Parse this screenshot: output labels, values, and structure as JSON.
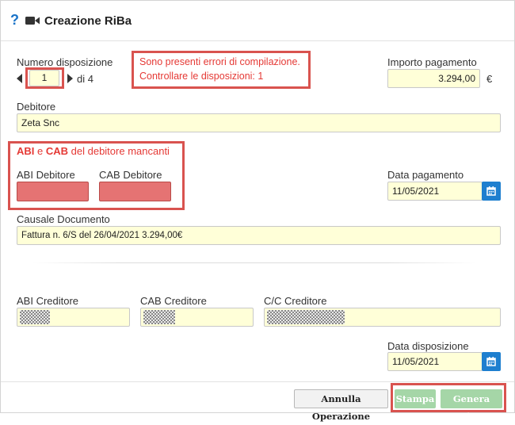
{
  "header": {
    "title": "Creazione RiBa",
    "help_icon": "?",
    "video_icon": "video-camera-icon"
  },
  "numero_disposizione": {
    "label": "Numero disposizione",
    "value": "1",
    "of_label": "di 4"
  },
  "errors": {
    "line1": "Sono presenti errori di compilazione.",
    "line2": "Controllare le disposizioni: 1"
  },
  "importo": {
    "label": "Importo pagamento",
    "value": "3.294,00",
    "currency": "€"
  },
  "debitore": {
    "label": "Debitore",
    "value": "Zeta Snc"
  },
  "abi_cab_error": {
    "abi": "ABI",
    "e": " e ",
    "cab": "CAB",
    "rest": " del debitore mancanti"
  },
  "abi_debitore": {
    "label": "ABI Debitore",
    "value": ""
  },
  "cab_debitore": {
    "label": "CAB Debitore",
    "value": ""
  },
  "data_pagamento": {
    "label": "Data pagamento",
    "value": "11/05/2021"
  },
  "causale": {
    "label": "Causale Documento",
    "value": "Fattura n. 6/S del 26/04/2021 3.294,00€"
  },
  "abi_creditore": {
    "label": "ABI Creditore"
  },
  "cab_creditore": {
    "label": "CAB Creditore"
  },
  "cc_creditore": {
    "label": "C/C Creditore"
  },
  "data_disposizione": {
    "label": "Data disposizione",
    "value": "11/05/2021"
  },
  "buttons": {
    "annulla": "Annulla Operazione",
    "stampa": "Stampa",
    "genera": "Genera RiBa"
  },
  "colors": {
    "accent": "#1e7fcf",
    "error": "#e53935",
    "field_bg": "#ffffd8",
    "error_field": "#e57373",
    "green_button": "#a5d6a7"
  }
}
